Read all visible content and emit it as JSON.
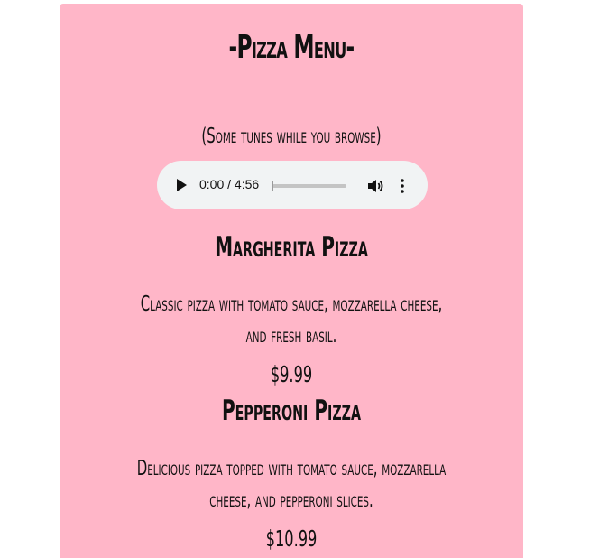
{
  "menu": {
    "title": "-Pizza Menu-",
    "subtitle": "(Some tunes while you browse)",
    "background_color": "#ffb6c8"
  },
  "audio_player": {
    "time": "0:00 / 4:56",
    "progress": 0,
    "play_icon": "play-icon",
    "volume_icon": "volume-icon",
    "more_icon": "more-options-icon"
  },
  "items": [
    {
      "name": "Margherita Pizza",
      "description_lines": [
        "Classic pizza with tomato sauce, mozzarella cheese,",
        "and fresh basil."
      ],
      "price": "$9.99"
    },
    {
      "name": "Pepperoni Pizza",
      "description_lines": [
        "Delicious pizza topped with tomato sauce, mozzarella",
        "cheese, and pepperoni slices."
      ],
      "price": "$10.99"
    }
  ]
}
